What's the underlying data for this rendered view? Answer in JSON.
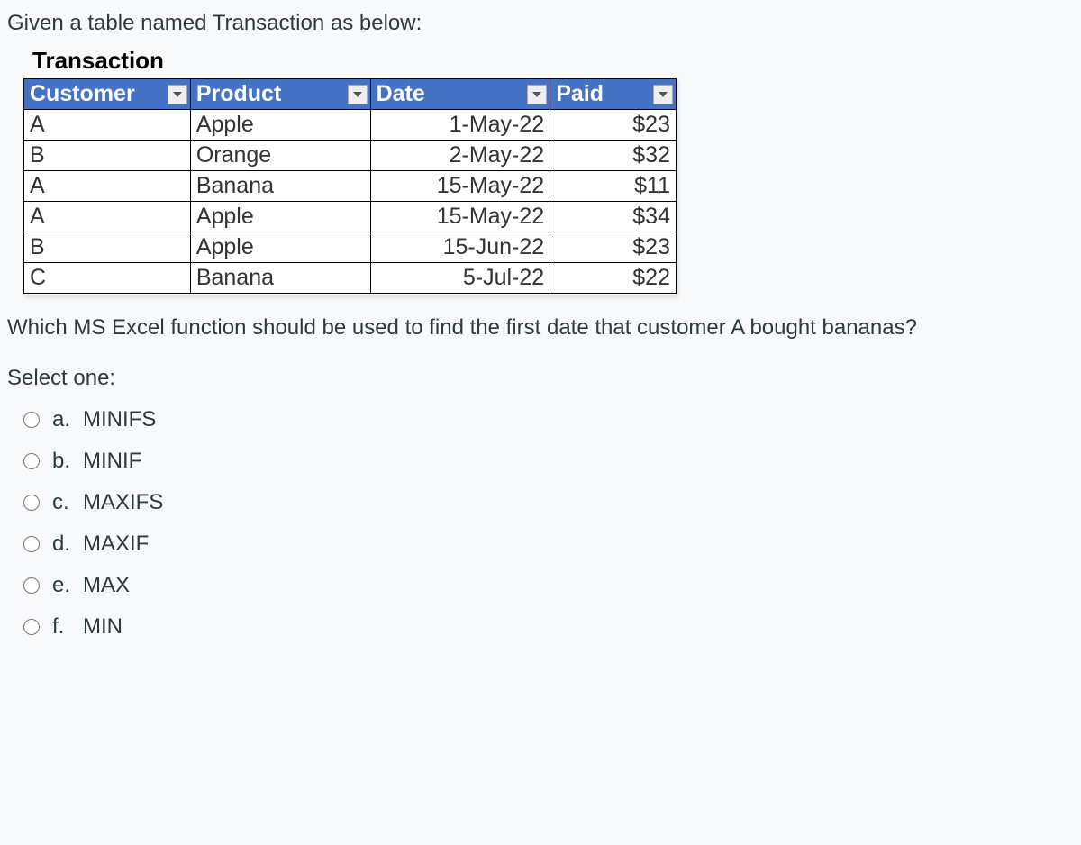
{
  "intro_text": "Given a table named Transaction as below:",
  "table_title": "Transaction",
  "table": {
    "headers": [
      "Customer",
      "Product",
      "Date",
      "Paid"
    ],
    "rows": [
      {
        "customer": "A",
        "product": "Apple",
        "date": "1-May-22",
        "paid": "$23"
      },
      {
        "customer": "B",
        "product": "Orange",
        "date": "2-May-22",
        "paid": "$32"
      },
      {
        "customer": "A",
        "product": "Banana",
        "date": "15-May-22",
        "paid": "$11"
      },
      {
        "customer": "A",
        "product": "Apple",
        "date": "15-May-22",
        "paid": "$34"
      },
      {
        "customer": "B",
        "product": "Apple",
        "date": "15-Jun-22",
        "paid": "$23"
      },
      {
        "customer": "C",
        "product": "Banana",
        "date": "5-Jul-22",
        "paid": "$22"
      }
    ]
  },
  "question_text": "Which MS Excel function should be used to find the first date that customer A bought bananas?",
  "select_one_label": "Select one:",
  "options": [
    {
      "letter": "a.",
      "text": "MINIFS"
    },
    {
      "letter": "b.",
      "text": "MINIF"
    },
    {
      "letter": "c.",
      "text": "MAXIFS"
    },
    {
      "letter": "d.",
      "text": "MAXIF"
    },
    {
      "letter": "e.",
      "text": "MAX"
    },
    {
      "letter": "f.",
      "text": "MIN"
    }
  ]
}
